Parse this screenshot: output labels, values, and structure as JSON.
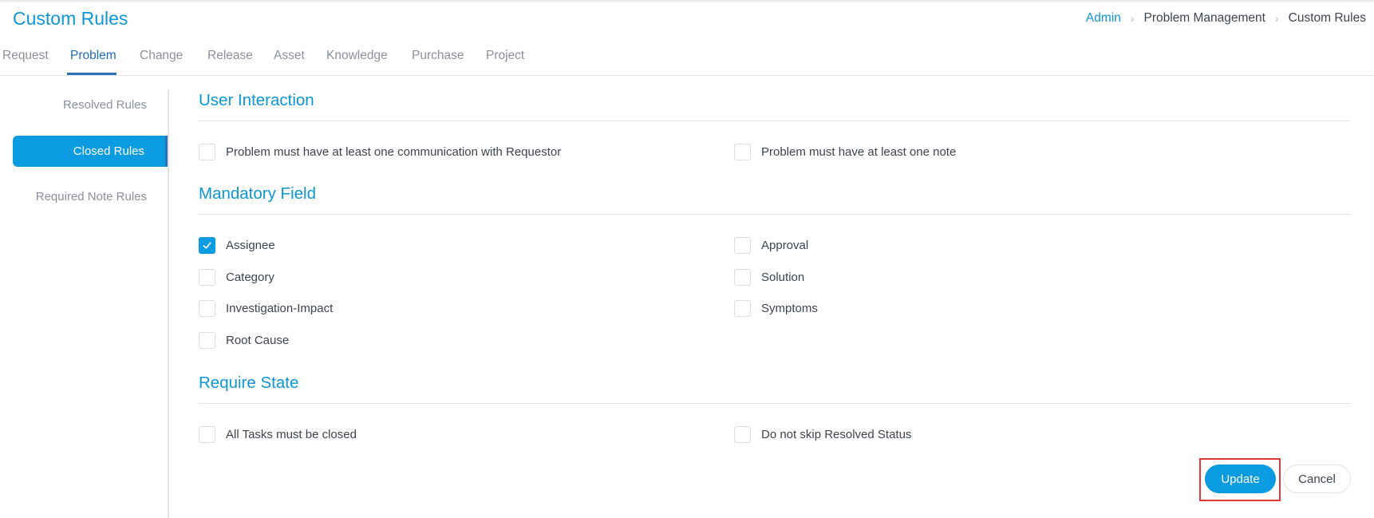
{
  "header": {
    "title": "Custom Rules",
    "breadcrumb": [
      {
        "label": "Admin",
        "link": true
      },
      {
        "label": "Problem Management",
        "link": false
      },
      {
        "label": "Custom Rules",
        "link": false
      }
    ],
    "separator": ">"
  },
  "tabs": [
    {
      "label": "Request",
      "active": false
    },
    {
      "label": "Problem",
      "active": true
    },
    {
      "label": "Change",
      "active": false
    },
    {
      "label": "Release",
      "active": false
    },
    {
      "label": "Asset",
      "active": false
    },
    {
      "label": "Knowledge",
      "active": false
    },
    {
      "label": "Purchase",
      "active": false
    },
    {
      "label": "Project",
      "active": false
    }
  ],
  "sidebar": {
    "items": [
      {
        "label": "Resolved Rules",
        "active": false
      },
      {
        "label": "Closed Rules",
        "active": true
      },
      {
        "label": "Required Note Rules",
        "active": false
      }
    ]
  },
  "sections": {
    "user_interaction": {
      "title": "User Interaction",
      "options": [
        {
          "label": "Problem must have at least one communication with Requestor",
          "checked": false
        },
        {
          "label": "Problem must have at least one note",
          "checked": false
        }
      ]
    },
    "mandatory_field": {
      "title": "Mandatory Field",
      "options": [
        {
          "label": "Assignee",
          "checked": true
        },
        {
          "label": "Approval",
          "checked": false
        },
        {
          "label": "Category",
          "checked": false
        },
        {
          "label": "Solution",
          "checked": false
        },
        {
          "label": "Investigation-Impact",
          "checked": false
        },
        {
          "label": "Symptoms",
          "checked": false
        },
        {
          "label": "Root Cause",
          "checked": false
        }
      ]
    },
    "require_state": {
      "title": "Require State",
      "options": [
        {
          "label": "All Tasks must be closed",
          "checked": false
        },
        {
          "label": "Do not skip Resolved Status",
          "checked": false
        }
      ]
    }
  },
  "actions": {
    "update_label": "Update",
    "cancel_label": "Cancel"
  },
  "colors": {
    "accent": "#0a9be0",
    "title": "#0d96d6",
    "tab_active": "#1f6cb8",
    "highlight": "#e53935"
  }
}
